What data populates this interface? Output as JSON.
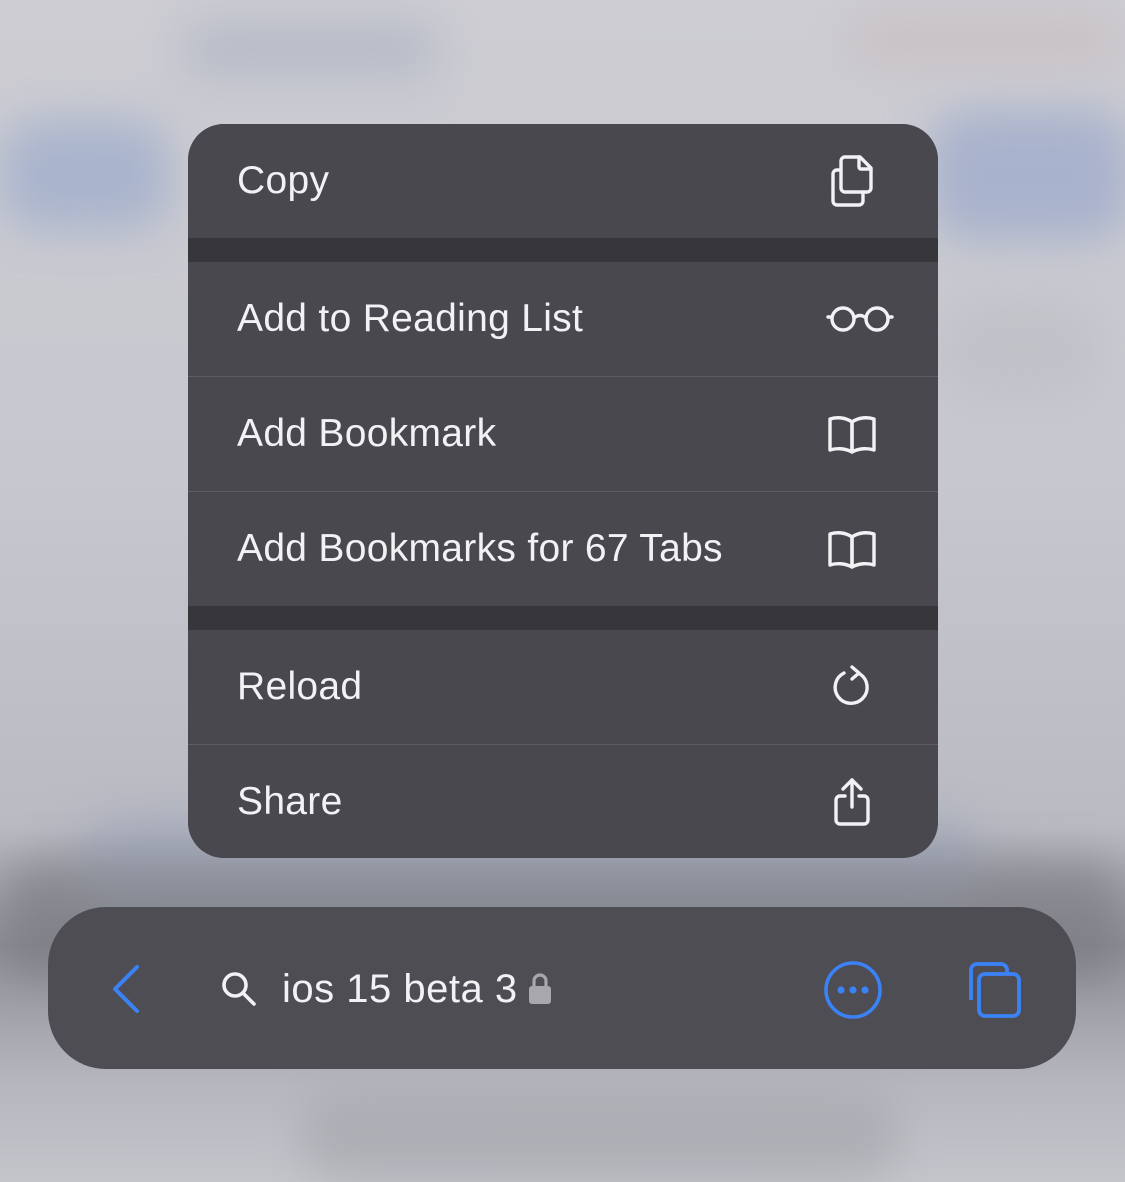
{
  "menu": {
    "items": [
      {
        "label": "Copy",
        "icon": "copy-icon"
      },
      {
        "label": "Add to Reading List",
        "icon": "glasses-icon"
      },
      {
        "label": "Add Bookmark",
        "icon": "book-icon"
      },
      {
        "label": "Add Bookmarks for 67 Tabs",
        "icon": "book-icon"
      },
      {
        "label": "Reload",
        "icon": "reload-icon"
      },
      {
        "label": "Share",
        "icon": "share-icon"
      }
    ]
  },
  "toolbar": {
    "back_icon": "chevron-left-icon",
    "search_icon": "search-icon",
    "address_text": "ios 15 beta 3",
    "lock_icon": "lock-icon",
    "more_icon": "ellipsis-circle-icon",
    "tabs_icon": "tabs-icon"
  },
  "colors": {
    "menu_background": "#48484e",
    "menu_separator": "#36363b",
    "toolbar_background": "#4d4d53",
    "accent_blue": "#3b82f6",
    "text": "#f2f2f5"
  }
}
